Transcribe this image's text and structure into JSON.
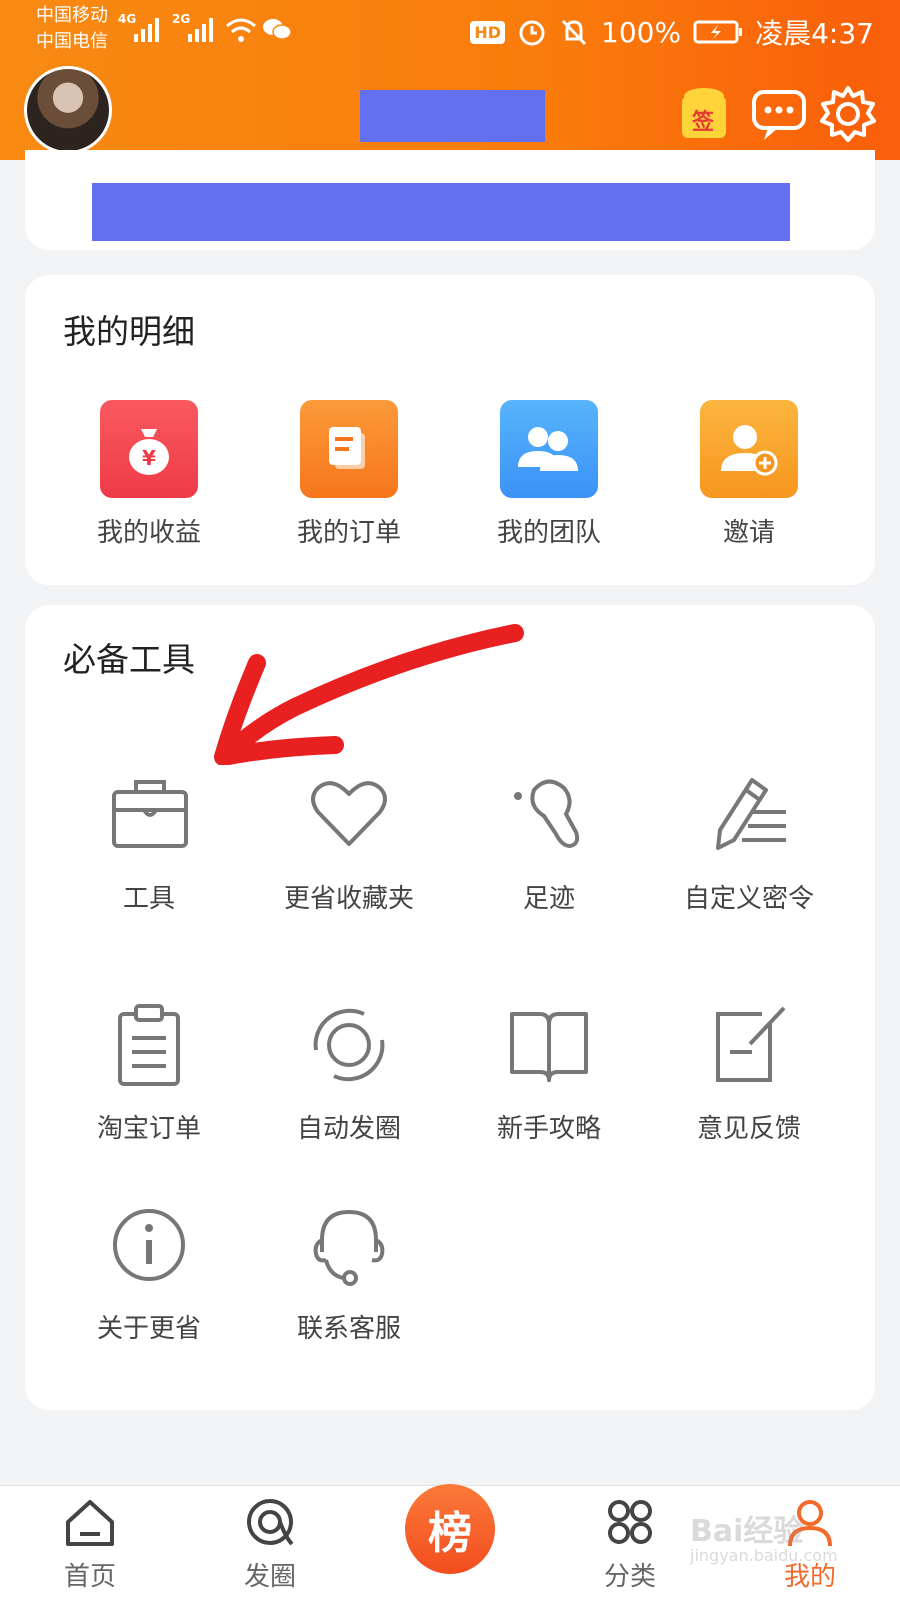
{
  "status_bar": {
    "carrier_1": "中国移动",
    "carrier_2": "中国电信",
    "net_1": "4G",
    "net_2": "2G",
    "hd": "HD",
    "battery": "100%",
    "time": "凌晨4:37"
  },
  "header": {
    "sign_in_badge": "签",
    "colors": {
      "start": "#f88a12",
      "end": "#f95e0a",
      "redaction": "#6270ef"
    }
  },
  "details": {
    "title": "我的明细",
    "items": [
      {
        "label": "我的收益",
        "icon": "money-bag-icon",
        "color": "#f34a55"
      },
      {
        "label": "我的订单",
        "icon": "orders-icon",
        "color": "#f9832a"
      },
      {
        "label": "我的团队",
        "icon": "team-icon",
        "color": "#4aa7fa"
      },
      {
        "label": "邀请",
        "icon": "invite-icon",
        "color": "#f9a22f"
      }
    ]
  },
  "tools": {
    "title": "必备工具",
    "items": [
      {
        "label": "工具",
        "icon": "toolbox-icon"
      },
      {
        "label": "更省收藏夹",
        "icon": "heart-icon"
      },
      {
        "label": "足迹",
        "icon": "footprint-icon"
      },
      {
        "label": "自定义密令",
        "icon": "pen-icon"
      },
      {
        "label": "淘宝订单",
        "icon": "clipboard-icon"
      },
      {
        "label": "自动发圈",
        "icon": "sync-circle-icon"
      },
      {
        "label": "新手攻略",
        "icon": "book-icon"
      },
      {
        "label": "意见反馈",
        "icon": "feedback-icon"
      },
      {
        "label": "关于更省",
        "icon": "info-icon"
      },
      {
        "label": "联系客服",
        "icon": "headset-icon"
      }
    ]
  },
  "bottom_nav": {
    "items": [
      {
        "label": "首页",
        "icon": "home-icon"
      },
      {
        "label": "发圈",
        "icon": "moments-icon"
      },
      {
        "label": "榜",
        "icon": "ranking-icon"
      },
      {
        "label": "分类",
        "icon": "category-icon"
      },
      {
        "label": "我的",
        "icon": "user-icon",
        "active": true
      }
    ],
    "active_color": "#f36a2c"
  },
  "watermark": {
    "line1": "Bai经验",
    "line2": "jingyan.baidu.com"
  }
}
